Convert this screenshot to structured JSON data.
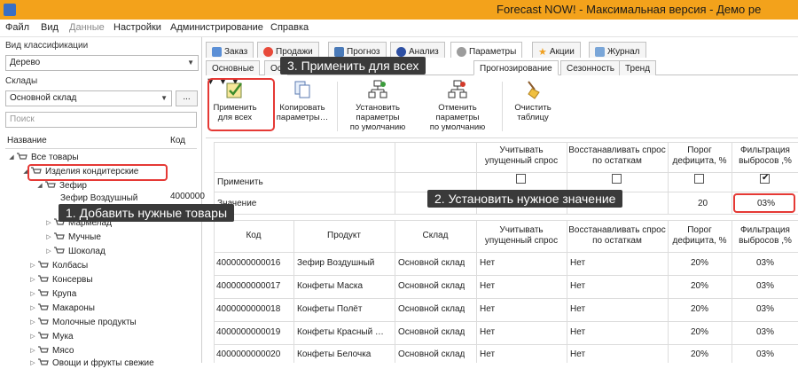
{
  "titlebar": {
    "title": "Forecast NOW! - Максимальная версия - Демо ре"
  },
  "menu": [
    {
      "label": "Файл",
      "disabled": false
    },
    {
      "label": "Вид",
      "disabled": false
    },
    {
      "label": "Данные",
      "disabled": true
    },
    {
      "label": "Настройки",
      "disabled": false
    },
    {
      "label": "Администрирование",
      "disabled": false
    },
    {
      "label": "Справка",
      "disabled": false
    }
  ],
  "left": {
    "classification_label": "Вид классификации",
    "classification_value": "Дерево",
    "warehouses_label": "Склады",
    "warehouse_value": "Основной склад",
    "more_button": "...",
    "search_placeholder": "Поиск",
    "tree_col_name": "Название",
    "tree_col_code": "Код",
    "tree": [
      {
        "label": "Все товары",
        "code": ""
      },
      {
        "label": "Изделия кондитерские",
        "code": ""
      },
      {
        "label": "Зефир",
        "code": ""
      },
      {
        "label": "Зефир Воздушный",
        "code": "4000000"
      },
      {
        "label": "Мармелад",
        "code": ""
      },
      {
        "label": "Мучные",
        "code": ""
      },
      {
        "label": "Шоколад",
        "code": ""
      },
      {
        "label": "Колбасы",
        "code": ""
      },
      {
        "label": "Консервы",
        "code": ""
      },
      {
        "label": "Крупа",
        "code": ""
      },
      {
        "label": "Макароны",
        "code": ""
      },
      {
        "label": "Молочные продукты",
        "code": ""
      },
      {
        "label": "Мука",
        "code": ""
      },
      {
        "label": "Мясо",
        "code": ""
      },
      {
        "label": "Овощи и фрукты свежие",
        "code": ""
      }
    ]
  },
  "callouts": {
    "step1": "1. Добавить нужные товары",
    "step2": "2. Установить нужное значение",
    "step3": "3. Применить для всех"
  },
  "tabs": [
    "Заказ",
    "Продажи",
    "Прогноз",
    "Анализ",
    "Параметры",
    "Акции",
    "Журнал"
  ],
  "subtabs": [
    "Основные",
    "Ос",
    "Прогнозирование",
    "Сезонность",
    "Тренд"
  ],
  "ribbon": {
    "apply_all": [
      "Применить",
      "для всех"
    ],
    "copy_params": [
      "Копировать",
      "параметры…"
    ],
    "set_default": [
      "Установить",
      "параметры",
      "по умолчанию"
    ],
    "cancel_default": [
      "Отменить",
      "параметры",
      "по умолчанию"
    ],
    "clear_table": [
      "Очистить",
      "таблицу"
    ]
  },
  "params_grid": {
    "columns": [
      "Учитывать упущенный спрос",
      "Восстанавливать спрос по остаткам",
      "Порог дефицита, %",
      "Фильтрация выбросов ,%"
    ],
    "apply_row_label": "Применить",
    "apply_checks": [
      false,
      false,
      false,
      true
    ],
    "value_row_label": "Значение",
    "value_row": [
      "",
      "",
      "20",
      "03%"
    ]
  },
  "products_grid": {
    "columns": [
      "Код",
      "Продукт",
      "Склад",
      "Учитывать упущенный спрос",
      "Восстанавливать спрос по остаткам",
      "Порог дефицита, %",
      "Фильтрация выбросов ,%"
    ],
    "rows": [
      [
        "4000000000016",
        "Зефир Воздушный",
        "Основной склад",
        "Нет",
        "Нет",
        "20%",
        "03%"
      ],
      [
        "4000000000017",
        "Конфеты Маска",
        "Основной склад",
        "Нет",
        "Нет",
        "20%",
        "03%"
      ],
      [
        "4000000000018",
        "Конфеты Полёт",
        "Основной склад",
        "Нет",
        "Нет",
        "20%",
        "03%"
      ],
      [
        "4000000000019",
        "Конфеты Красный …",
        "Основной склад",
        "Нет",
        "Нет",
        "20%",
        "03%"
      ],
      [
        "4000000000020",
        "Конфеты Белочка",
        "Основной склад",
        "Нет",
        "Нет",
        "20%",
        "03%"
      ]
    ]
  },
  "colors": {
    "titlebar": "#f3a21b",
    "highlight": "#e53935",
    "callout_bg": "#3a3a3a"
  }
}
